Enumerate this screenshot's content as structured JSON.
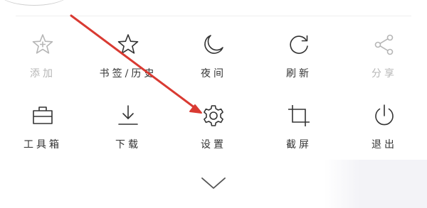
{
  "menu": {
    "items": [
      {
        "id": "add",
        "label": "添加",
        "icon": "star-plus-icon",
        "enabled": false
      },
      {
        "id": "bookmarks",
        "label": "书签/历史",
        "icon": "star-icon",
        "enabled": true
      },
      {
        "id": "night",
        "label": "夜间",
        "icon": "moon-icon",
        "enabled": true
      },
      {
        "id": "refresh",
        "label": "刷新",
        "icon": "refresh-icon",
        "enabled": true
      },
      {
        "id": "share",
        "label": "分享",
        "icon": "share-icon",
        "enabled": false
      },
      {
        "id": "tools",
        "label": "工具箱",
        "icon": "toolbox-icon",
        "enabled": true
      },
      {
        "id": "download",
        "label": "下载",
        "icon": "download-icon",
        "enabled": true
      },
      {
        "id": "settings",
        "label": "设置",
        "icon": "gear-icon",
        "enabled": true
      },
      {
        "id": "screenshot",
        "label": "截屏",
        "icon": "crop-icon",
        "enabled": true
      },
      {
        "id": "exit",
        "label": "退出",
        "icon": "power-icon",
        "enabled": true
      }
    ],
    "collapse_icon": "chevron-down-icon"
  },
  "colors": {
    "icon": "#333333",
    "disabled": "#b6b6b6",
    "annotation_arrow": "#d93a32",
    "background": "#ffffff"
  }
}
